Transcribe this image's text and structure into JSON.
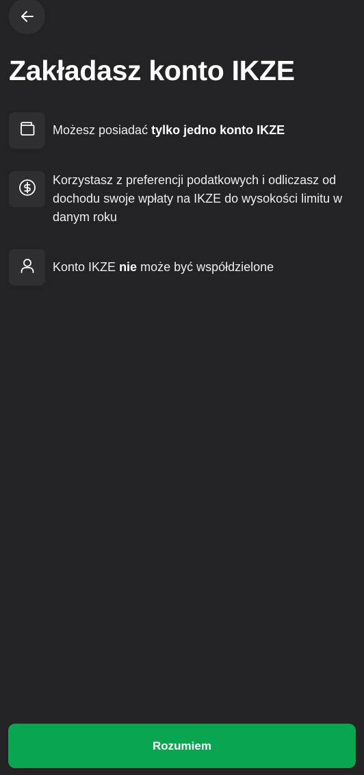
{
  "header": {
    "back_icon": "arrow-left-icon",
    "title": "Zakładasz konto IKZE"
  },
  "items": [
    {
      "icon": "wallet-icon",
      "text_before": "Możesz posiadać ",
      "text_bold": "tylko jedno konto IKZE",
      "text_after": ""
    },
    {
      "icon": "dollar-circle-icon",
      "text_before": "Korzystasz z preferencji podatkowych i odliczasz od dochodu swoje wpłaty na IKZE do wysokości limitu w danym roku",
      "text_bold": "",
      "text_after": ""
    },
    {
      "icon": "user-icon",
      "text_before": "Konto IKZE ",
      "text_bold": "nie",
      "text_after": " może być współdzielone"
    }
  ],
  "footer": {
    "confirm_label": "Rozumiem"
  },
  "colors": {
    "background": "#232325",
    "surface": "#2f2f32",
    "accent": "#0aa550",
    "text": "#ffffff"
  }
}
